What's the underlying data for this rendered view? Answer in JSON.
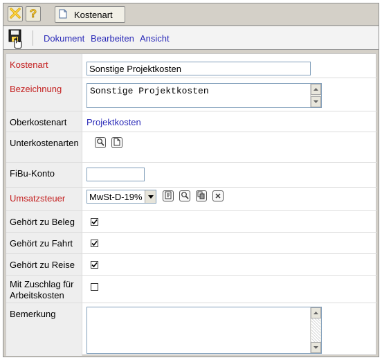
{
  "toolbar": {
    "close_icon": "close-x-icon",
    "help_icon": "help-question-icon",
    "tab_label": "Kostenart"
  },
  "menu": {
    "save_icon": "floppy-save-icon",
    "items": [
      "Dokument",
      "Bearbeiten",
      "Ansicht"
    ]
  },
  "form": {
    "kostenart": {
      "label": "Kostenart",
      "value": "Sonstige Projektkosten",
      "required": true
    },
    "bezeichnung": {
      "label": "Bezeichnung",
      "value": "Sonstige Projektkosten",
      "required": true
    },
    "oberkostenart": {
      "label": "Oberkostenart",
      "value": "Projektkosten"
    },
    "unterkostenarten": {
      "label": "Unterkostenarten",
      "icons": [
        "search-icon",
        "new-document-icon"
      ]
    },
    "fibu_konto": {
      "label": "FiBu-Konto",
      "value": ""
    },
    "umsatzsteuer": {
      "label": "Umsatzsteuer",
      "value": "MwSt-D-19%",
      "required": true,
      "icons": [
        "details-icon",
        "search-icon",
        "copy-icon",
        "clear-icon"
      ]
    },
    "gehoert_beleg": {
      "label": "Gehört zu Beleg",
      "checked": true
    },
    "gehoert_fahrt": {
      "label": "Gehört zu Fahrt",
      "checked": true
    },
    "gehoert_reise": {
      "label": "Gehört zu Reise",
      "checked": true
    },
    "zuschlag": {
      "label_line1": "Mit Zuschlag für",
      "label_line2": "Arbeitskosten",
      "checked": false
    },
    "bemerkung": {
      "label": "Bemerkung",
      "value": ""
    }
  },
  "colors": {
    "required_label": "#c42020",
    "link": "#2a2ab8",
    "label_bg": "#eeeeee",
    "chrome": "#d4d0c8"
  }
}
